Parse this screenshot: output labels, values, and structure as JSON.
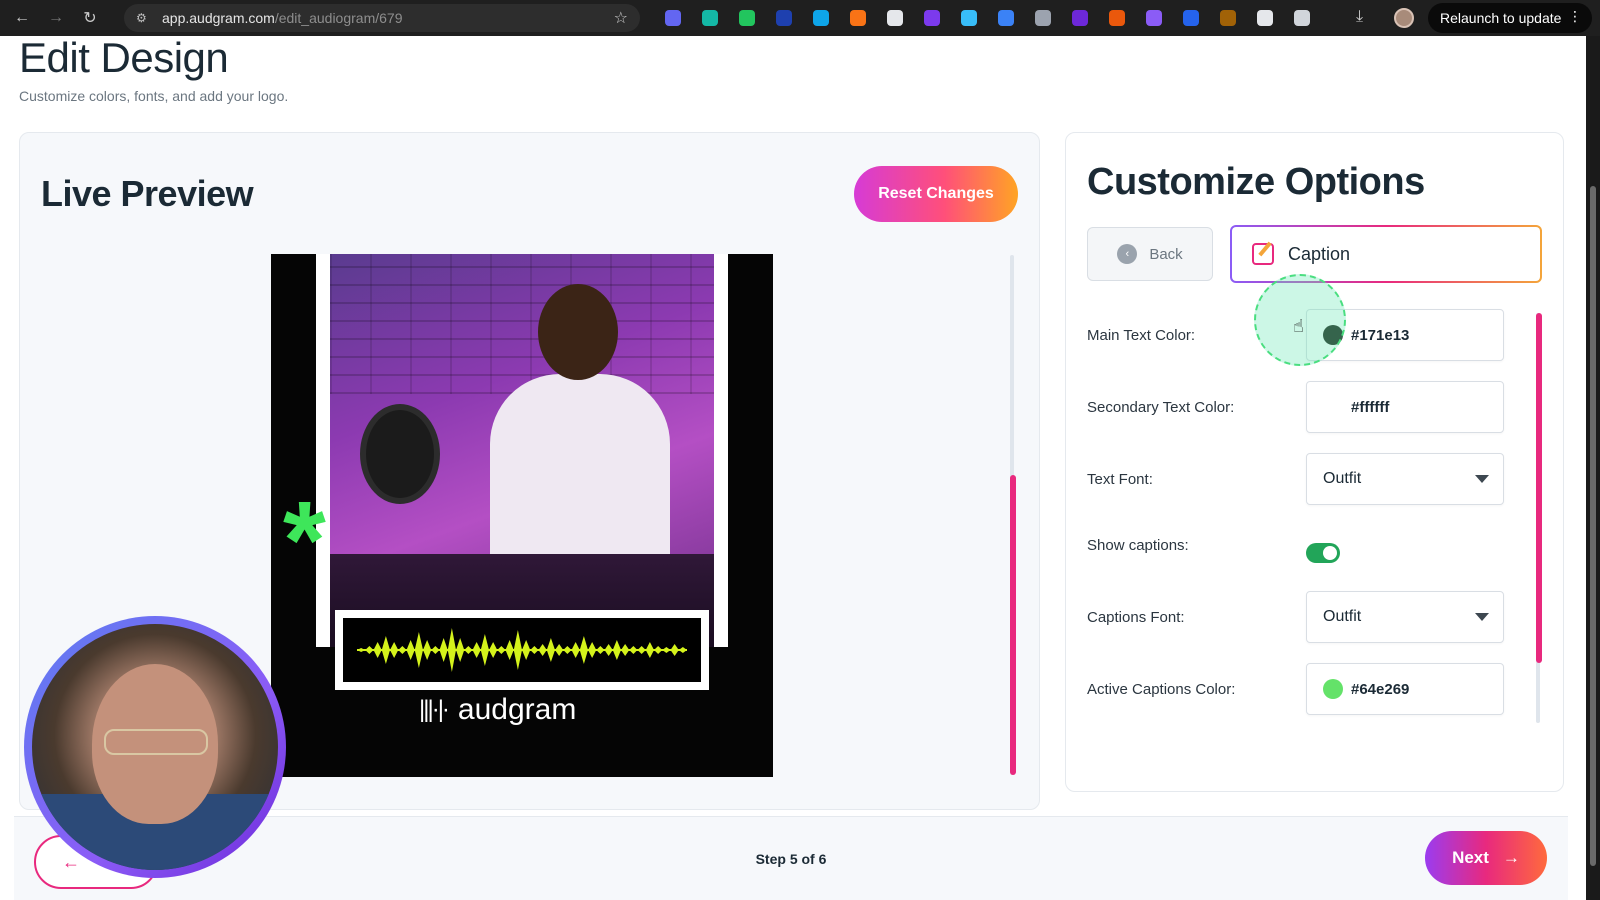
{
  "browser": {
    "url_host": "app.audgram.com",
    "url_path": "/edit_audiogram/679",
    "relaunch_label": "Relaunch to update",
    "extension_colors": [
      "#6366f1",
      "#14b8a6",
      "#22c55e",
      "#1e40af",
      "#0ea5e9",
      "#f97316",
      "#e5e7eb",
      "#7c3aed",
      "#38bdf8",
      "#3b82f6",
      "#9ca3af",
      "#6d28d9",
      "#ea580c",
      "#8b5cf6",
      "#2563eb",
      "#a16207",
      "#e5e7eb",
      "#d1d5db"
    ]
  },
  "page": {
    "title": "Edit Design",
    "subtitle": "Customize colors, fonts, and add your logo."
  },
  "preview": {
    "title": "Live Preview",
    "reset_label": "Reset Changes",
    "logo_text": "audgram",
    "logo_mark": "|||·|·",
    "waveform_color": "#d4f21b",
    "asterisk": "*",
    "asterisk_color": "#3ee65a"
  },
  "options": {
    "title": "Customize Options",
    "back_label": "Back",
    "active_tab_label": "Caption",
    "rows": {
      "main_text_color": {
        "label": "Main Text Color:",
        "value": "#171e13",
        "swatch": "#171e13"
      },
      "secondary_text_color": {
        "label": "Secondary Text Color:",
        "value": "#ffffff",
        "swatch": "#ffffff"
      },
      "text_font": {
        "label": "Text Font:",
        "value": "Outfit"
      },
      "show_captions": {
        "label": "Show captions:",
        "enabled": true
      },
      "captions_font": {
        "label": "Captions Font:",
        "value": "Outfit"
      },
      "active_captions_color": {
        "label": "Active Captions Color:",
        "value": "#64e269",
        "swatch": "#64e269"
      }
    }
  },
  "footer": {
    "prev_arrow": "←",
    "step_text": "Step 5 of 6",
    "next_label": "Next",
    "next_arrow": "→"
  },
  "colors": {
    "accent_pink": "#e8297e",
    "toggle_on": "#22a559"
  }
}
